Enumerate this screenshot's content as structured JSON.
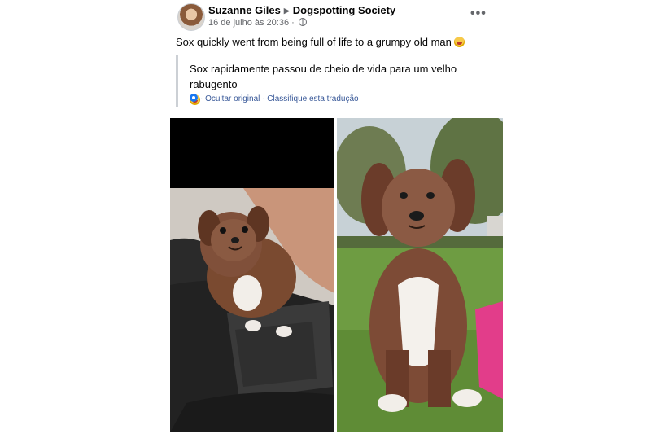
{
  "post": {
    "author": "Suzanne Giles",
    "group": "Dogspotting Society",
    "timestamp": "16 de julho às 20:36",
    "visibility_icon": "globe-icon",
    "more_icon": "ellipsis-icon",
    "text": "Sox quickly went from being full of life to a grumpy old man",
    "emoji": "rolling-on-floor-laughing-emoji"
  },
  "translation": {
    "text": "Sox rapidamente passou de cheio de vida para um velho rabugento",
    "hide_original": "Ocultar original",
    "separator": "·",
    "rate": "Classifique esta tradução",
    "icon": "gear-icon"
  },
  "colors": {
    "link": "#385898",
    "secondary_text": "#65676b",
    "divider": "#ccd0d5",
    "accent": "#1877f2"
  }
}
